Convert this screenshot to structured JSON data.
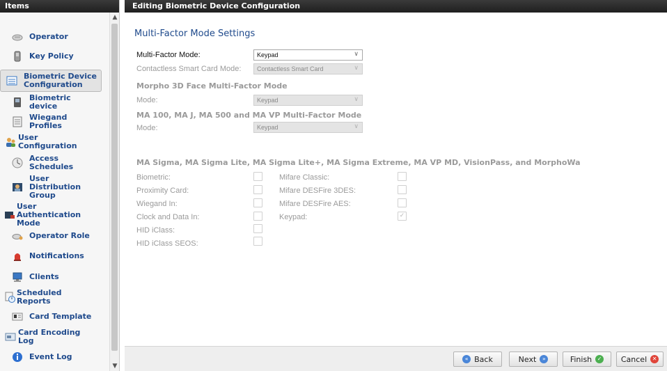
{
  "sidebar": {
    "header": "Items",
    "items": [
      {
        "label": "Operator",
        "icon": "operator-icon"
      },
      {
        "label": "Key Policy",
        "icon": "key-policy-icon"
      },
      {
        "label": "Biometric Device\nConfiguration",
        "icon": "biometric-device-config-icon",
        "active": true
      },
      {
        "label": "Biometric device",
        "icon": "biometric-device-icon"
      },
      {
        "label": "Wiegand Profiles",
        "icon": "wiegand-profiles-icon"
      },
      {
        "label": "User Configuration",
        "icon": "user-configuration-icon"
      },
      {
        "label": "Access Schedules",
        "icon": "access-schedules-icon"
      },
      {
        "label": "User Distribution\nGroup",
        "icon": "user-distribution-icon"
      },
      {
        "label": "User Authentication\nMode",
        "icon": "user-authentication-icon"
      },
      {
        "label": "Operator Role",
        "icon": "operator-role-icon"
      },
      {
        "label": "Notifications",
        "icon": "notifications-icon"
      },
      {
        "label": "Clients",
        "icon": "clients-icon"
      },
      {
        "label": "Scheduled Reports",
        "icon": "scheduled-reports-icon"
      },
      {
        "label": "Card Template",
        "icon": "card-template-icon"
      },
      {
        "label": "Card Encoding Log",
        "icon": "card-encoding-log-icon"
      },
      {
        "label": "Event Log",
        "icon": "event-log-icon"
      }
    ]
  },
  "main": {
    "header": "Editing Biometric Device Configuration",
    "section_title": "Multi-Factor Mode Settings",
    "multi_factor_mode": {
      "label": "Multi-Factor Mode:",
      "value": "Keypad"
    },
    "contactless_mode": {
      "label": "Contactless Smart Card Mode:",
      "value": "Contactless Smart Card"
    },
    "morpho_heading": "Morpho 3D Face Multi-Factor Mode",
    "morpho_mode": {
      "label": "Mode:",
      "value": "Keypad"
    },
    "ma_heading": "MA 100, MA J, MA 500 and MA VP Multi-Factor Mode",
    "ma_mode": {
      "label": "Mode:",
      "value": "Keypad"
    },
    "sigma_heading": "MA Sigma, MA Sigma Lite, MA Sigma Lite+, MA Sigma Extreme, MA VP MD, VisionPass, and MorphoWa",
    "left_checks": [
      {
        "label": "Biometric:",
        "checked": false
      },
      {
        "label": "Proximity Card:",
        "checked": false
      },
      {
        "label": "Wiegand In:",
        "checked": false
      },
      {
        "label": "Clock and Data In:",
        "checked": false
      },
      {
        "label": "HID iClass:",
        "checked": false
      },
      {
        "label": "HID iClass SEOS:",
        "checked": false
      }
    ],
    "right_checks": [
      {
        "label": "Mifare Classic:",
        "checked": false
      },
      {
        "label": "Mifare DESFire 3DES:",
        "checked": false
      },
      {
        "label": "Mifare DESFire AES:",
        "checked": false
      },
      {
        "label": "Keypad:",
        "checked": true
      }
    ]
  },
  "footer": {
    "back": "Back",
    "next": "Next",
    "finish": "Finish",
    "cancel": "Cancel"
  },
  "colors": {
    "header_bg": "#262626",
    "link_blue": "#1f4a8c",
    "disabled_text": "#9a9a9a"
  }
}
